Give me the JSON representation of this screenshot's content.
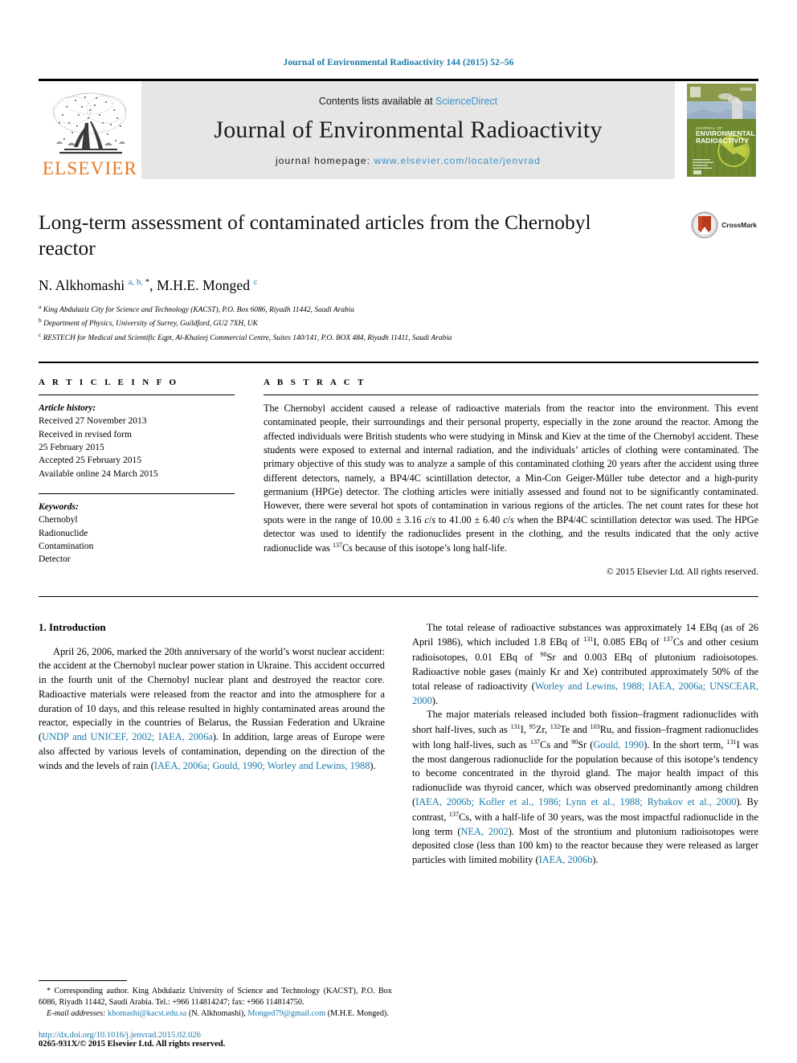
{
  "running_head": "Journal of Environmental Radioactivity 144 (2015) 52–56",
  "masthead": {
    "publisher_name": "ELSEVIER",
    "contents_prefix": "Contents lists available at ",
    "contents_link": "ScienceDirect",
    "journal_title": "Journal of Environmental Radioactivity",
    "homepage_label": "journal homepage: ",
    "homepage_url": "www.elsevier.com/locate/jenvrad",
    "cover_title_line1": "JOURNAL OF",
    "cover_title_line2": "ENVIRONMENTAL",
    "cover_title_line3": "RADIOACTIVITY"
  },
  "article": {
    "title": "Long-term assessment of contaminated articles from the Chernobyl reactor",
    "crossmark_label": "CrossMark",
    "authors_html": "N. Alkhomashi <sup>a, b, </sup><sup class=\"star\">*</sup>, M.H.E. Monged <sup>c</sup>",
    "affiliations": [
      {
        "marker": "a",
        "text": "King Abdulaziz City for Science and Technology (KACST), P.O. Box 6086, Riyadh 11442, Saudi Arabia"
      },
      {
        "marker": "b",
        "text": "Department of Physics, University of Surrey, Guildford, GU2 7XH, UK"
      },
      {
        "marker": "c",
        "text": "RESTECH for Medical and Scientific Eqpt, Al-Khaleej Commercial Centre, Suites 140/141, P.O. BOX 484, Riyadh 11411, Saudi Arabia"
      }
    ]
  },
  "article_info": {
    "heading": "A R T I C L E   I N F O",
    "history_label": "Article history:",
    "history": [
      "Received 27 November 2013",
      "Received in revised form",
      "25 February 2015",
      "Accepted 25 February 2015",
      "Available online 24 March 2015"
    ],
    "keywords_label": "Keywords:",
    "keywords": [
      "Chernobyl",
      "Radionuclide",
      "Contamination",
      "Detector"
    ]
  },
  "abstract": {
    "heading": "A B S T R A C T",
    "text_html": "The Chernobyl accident caused a release of radioactive materials from the reactor into the environment. This event contaminated people, their surroundings and their personal property, especially in the zone around the reactor. Among the affected individuals were British students who were studying in Minsk and Kiev at the time of the Chernobyl accident. These students were exposed to external and internal radiation, and the individuals&rsquo; articles of clothing were contaminated. The primary objective of this study was to analyze a sample of this contaminated clothing 20 years after the accident using three different detectors, namely, a BP4/4C scintillation detector, a Min-Con Geiger-M&uuml;ller tube detector and a high-purity germanium (HPGe) detector. The clothing articles were initially assessed and found not to be significantly contaminated. However, there were several hot spots of contamination in various regions of the articles. The net count rates for these hot spots were in the range of 10.00 &plusmn; 3.16 <em>c</em>/<em>s</em> to 41.00 &plusmn; 6.40 <em>c</em>/<em>s</em> when the BP4/4C scintillation detector was used. The HPGe detector was used to identify the radionuclides present in the clothing, and the results indicated that the only active radionuclide was <sup class=\"nuc\">137</sup>Cs because of this isotope&rsquo;s long half-life.",
    "copyright": "© 2015 Elsevier Ltd. All rights reserved."
  },
  "body": {
    "section_title": "1. Introduction",
    "left_paragraph_html": "April 26, 2006, marked the 20th anniversary of the world&rsquo;s worst nuclear accident: the accident at the Chernobyl nuclear power station in Ukraine. This accident occurred in the fourth unit of the Chernobyl nuclear plant and destroyed the reactor core. Radioactive materials were released from the reactor and into the atmosphere for a duration of 10 days, and this release resulted in highly contaminated areas around the reactor, especially in the countries of Belarus, the Russian Federation and Ukraine (<span class=\"ref\">UNDP and UNICEF, 2002; IAEA, 2006a</span>). In addition, large areas of Europe were also affected by various levels of contamination, depending on the direction of the winds and the levels of rain (<span class=\"ref\">IAEA, 2006a; Gould, 1990; Worley and Lewins, 1988</span>).",
    "right_paragraph_1_html": "The total release of radioactive substances was approximately 14 EBq (as of 26 April 1986), which included 1.8 EBq of <sup class=\"nuc\">131</sup>I, 0.085 EBq of <sup class=\"nuc\">137</sup>Cs and other cesium radioisotopes, 0.01 EBq of <sup class=\"nuc\">90</sup>Sr and 0.003 EBq of plutonium radioisotopes. Radioactive noble gases (mainly Kr and Xe) contributed approximately 50% of the total release of radioactivity (<span class=\"ref\">Worley and Lewins, 1988; IAEA, 2006a; UNSCEAR, 2000</span>).",
    "right_paragraph_2_html": "The major materials released included both fission&ndash;fragment radionuclides with short half-lives, such as <sup class=\"nuc\">131</sup>I, <sup class=\"nuc\">95</sup>Zr, <sup class=\"nuc\">132</sup>Te and <sup class=\"nuc\">103</sup>Ru, and fission&ndash;fragment radionuclides with long half-lives, such as <sup class=\"nuc\">137</sup>Cs and <sup class=\"nuc\">90</sup>Sr (<span class=\"ref\">Gould, 1990</span>). In the short term, <sup class=\"nuc\">131</sup>I was the most dangerous radionuclide for the population because of this isotope&rsquo;s tendency to become concentrated in the thyroid gland. The major health impact of this radionuclide was thyroid cancer, which was observed predominantly among children (<span class=\"ref\">IAEA, 2006b; Kofler et al., 1986; Lynn et al., 1988; Rybakov et al., 2000</span>). By contrast, <sup class=\"nuc\">137</sup>Cs, with a half-life of 30 years, was the most impactful radionuclide in the long term (<span class=\"ref\">NEA, 2002</span>). Most of the strontium and plutonium radioisotopes were deposited close (less than 100 km) to the reactor because they were released as larger particles with limited mobility (<span class=\"ref\">IAEA, 2006b</span>)."
  },
  "footnote": {
    "corresponding_html": "<span class=\"lead\">* Corresponding author. King Abdulaziz University of Science and Technology (KACST), P.O. Box 6086, Riyadh 11442, Saudi Arabia. Tel.: +966 114814247; fax: +966 114814750.</span>",
    "emails_html": "<span class=\"lead\"><em>E-mail addresses:</em> <span class=\"ref\">khomashi@kacst.edu.sa</span> (N. Alkhomashi), <span class=\"ref\">Monged79@gmail.com</span> (M.H.E. Monged).</span>",
    "doi": "http://dx.doi.org/10.1016/j.jenvrad.2015.02.026",
    "issn": "0265-931X/© 2015 Elsevier Ltd. All rights reserved."
  },
  "colors": {
    "link_blue": "#1a7aab",
    "sciencedirect_blue": "#3a93c9",
    "elsevier_orange": "#e87722",
    "banner_grey": "#e6e6e6"
  }
}
